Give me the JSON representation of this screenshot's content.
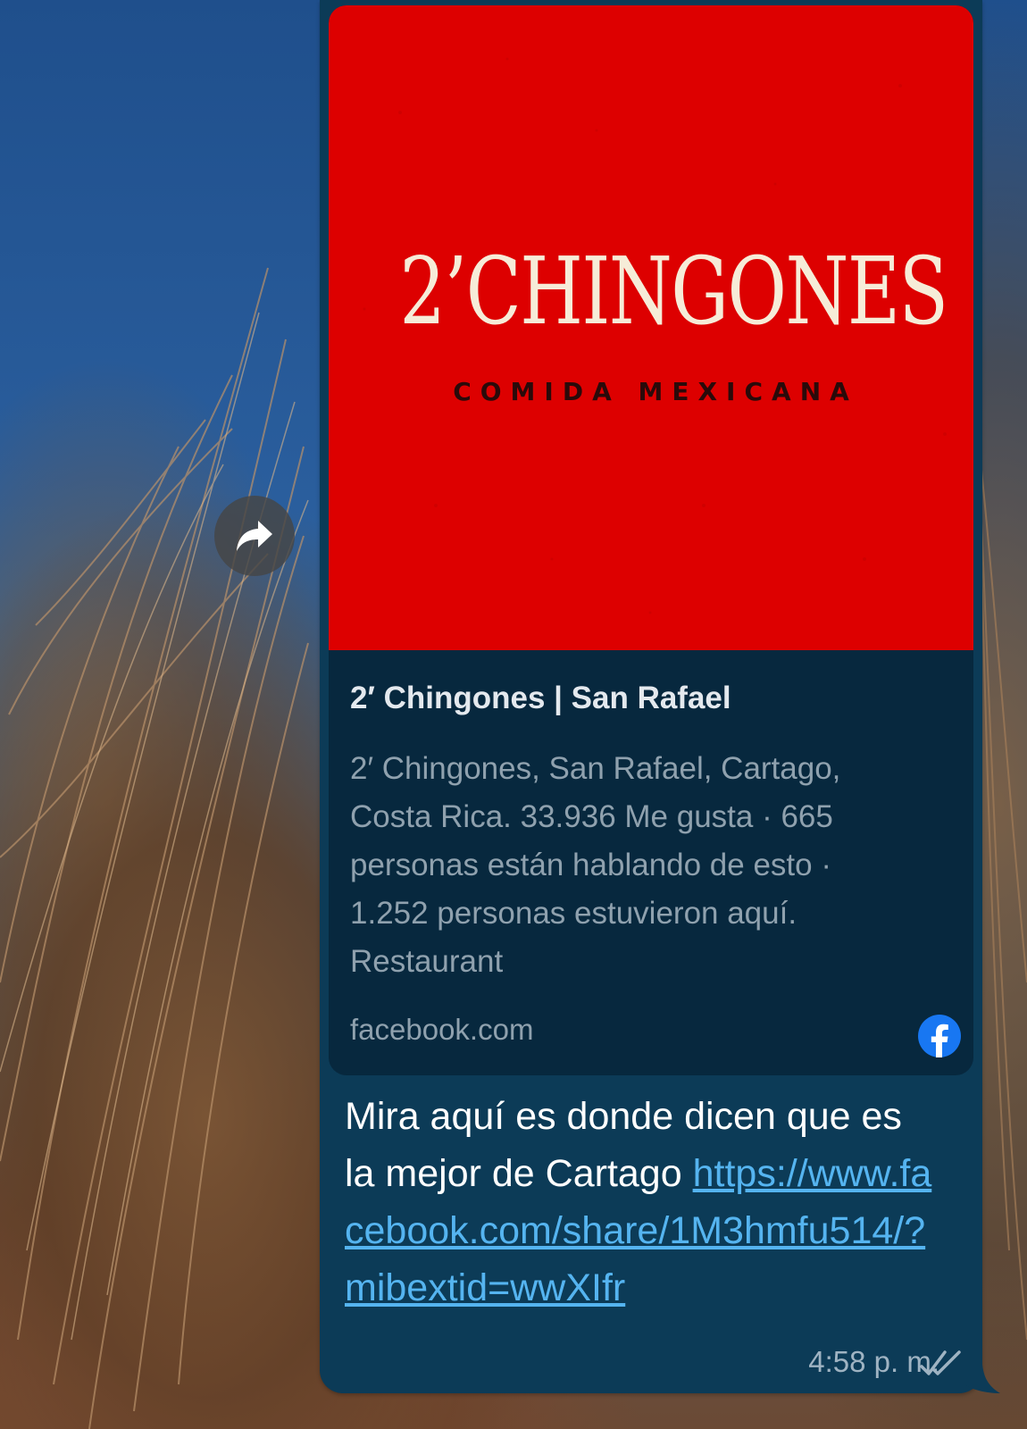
{
  "preview": {
    "logo_main": "2’CHINGONES",
    "logo_sub": "COMIDA MEXICANA",
    "title": "2′ Chingones | San Rafael",
    "description": "2′ Chingones, San Rafael, Cartago, Costa Rica. 33.936 Me gusta · 665 personas están hablando de esto · 1.252 personas estuvieron aquí. Restaurant",
    "domain": "facebook.com",
    "image_color": "#dd0000",
    "source_icon": "facebook-icon"
  },
  "message": {
    "text": "Mira aquí es donde dicen que es la mejor de Cartago",
    "link": "https://www.facebook.com/share/1M3hmfu514/?mibextid=wwXIfr",
    "time": "4:58 p. m.",
    "status_icon": "double-check-icon"
  },
  "actions": {
    "forward_icon": "forward-arrow-icon"
  },
  "colors": {
    "bubble": "#0c3b57",
    "card": "#07283e",
    "link": "#55b4f0"
  }
}
